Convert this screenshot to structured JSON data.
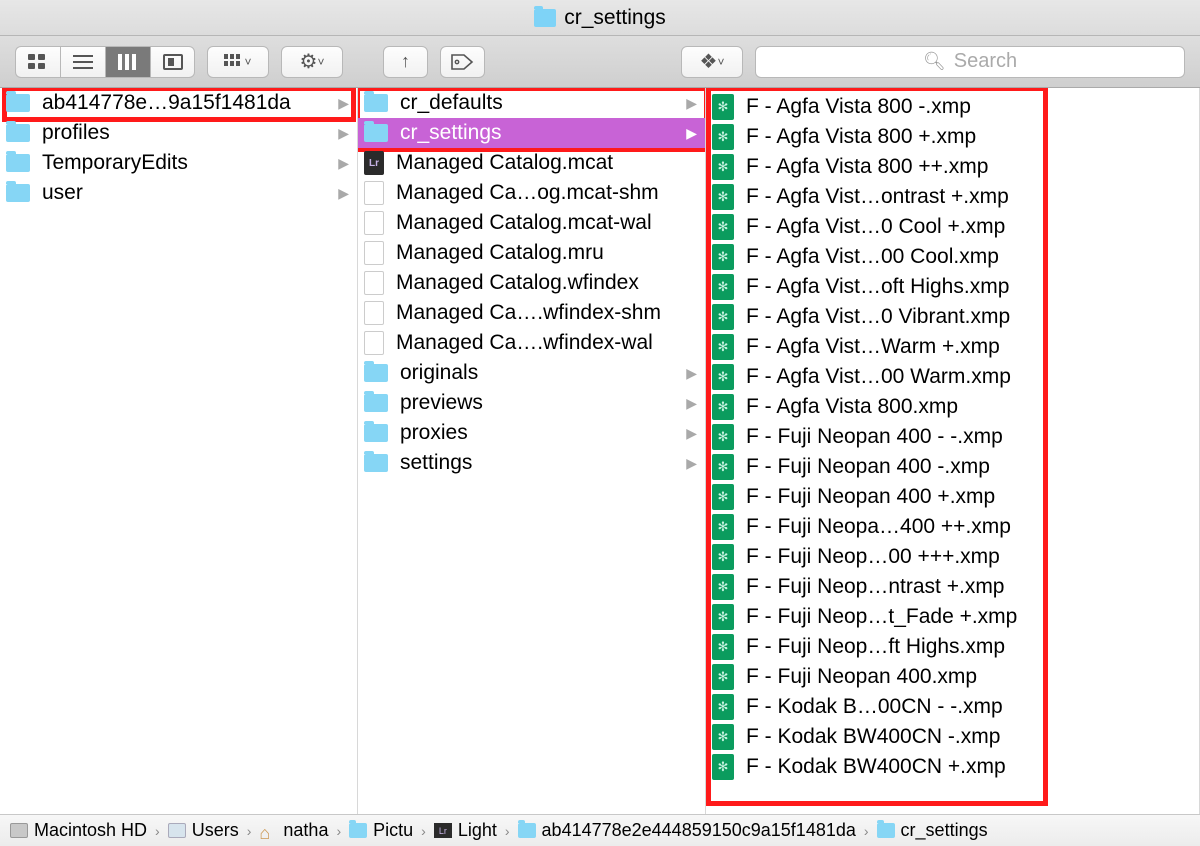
{
  "window_title": "cr_settings",
  "search_placeholder": "Search",
  "col1": [
    {
      "name": "ab414778e…9a15f1481da",
      "type": "folder",
      "hasChildren": true,
      "selected": true
    },
    {
      "name": "profiles",
      "type": "folder",
      "hasChildren": true
    },
    {
      "name": "TemporaryEdits",
      "type": "folder",
      "hasChildren": true
    },
    {
      "name": "user",
      "type": "folder",
      "hasChildren": true
    }
  ],
  "col2": [
    {
      "name": "cr_defaults",
      "type": "folder",
      "hasChildren": true
    },
    {
      "name": "cr_settings",
      "type": "folder",
      "hasChildren": true,
      "selected": true
    },
    {
      "name": "Managed Catalog.mcat",
      "type": "lr"
    },
    {
      "name": "Managed Ca…og.mcat-shm",
      "type": "file"
    },
    {
      "name": "Managed Catalog.mcat-wal",
      "type": "file"
    },
    {
      "name": "Managed Catalog.mru",
      "type": "file"
    },
    {
      "name": "Managed Catalog.wfindex",
      "type": "file"
    },
    {
      "name": "Managed Ca….wfindex-shm",
      "type": "file"
    },
    {
      "name": "Managed Ca….wfindex-wal",
      "type": "file"
    },
    {
      "name": "originals",
      "type": "folder",
      "hasChildren": true
    },
    {
      "name": "previews",
      "type": "folder",
      "hasChildren": true
    },
    {
      "name": "proxies",
      "type": "folder",
      "hasChildren": true
    },
    {
      "name": "settings",
      "type": "folder",
      "hasChildren": true
    }
  ],
  "col3": [
    "F - Agfa Vista 800 -.xmp",
    "F - Agfa Vista 800 +.xmp",
    "F - Agfa Vista 800 ++.xmp",
    "F - Agfa Vist…ontrast +.xmp",
    "F - Agfa Vist…0 Cool +.xmp",
    "F - Agfa Vist…00 Cool.xmp",
    "F - Agfa Vist…oft Highs.xmp",
    "F - Agfa Vist…0 Vibrant.xmp",
    "F - Agfa Vist…Warm +.xmp",
    "F - Agfa Vist…00 Warm.xmp",
    "F - Agfa Vista 800.xmp",
    "F - Fuji Neopan 400 - -.xmp",
    "F - Fuji Neopan 400 -.xmp",
    "F - Fuji Neopan 400 +.xmp",
    "F - Fuji Neopa…400 ++.xmp",
    "F - Fuji Neop…00 +++.xmp",
    "F - Fuji Neop…ntrast +.xmp",
    "F - Fuji Neop…t_Fade +.xmp",
    "F - Fuji Neop…ft Highs.xmp",
    "F - Fuji Neopan 400.xmp",
    "F - Kodak B…00CN - -.xmp",
    "F - Kodak BW400CN -.xmp",
    "F - Kodak BW400CN +.xmp"
  ],
  "path": [
    {
      "icon": "disk",
      "label": "Macintosh HD"
    },
    {
      "icon": "user",
      "label": "Users"
    },
    {
      "icon": "home",
      "label": "natha"
    },
    {
      "icon": "fold",
      "label": "Pictu"
    },
    {
      "icon": "lr",
      "label": "Light"
    },
    {
      "icon": "fold",
      "label": "ab414778e2e444859150c9a15f1481da"
    },
    {
      "icon": "fold",
      "label": "cr_settings"
    }
  ]
}
